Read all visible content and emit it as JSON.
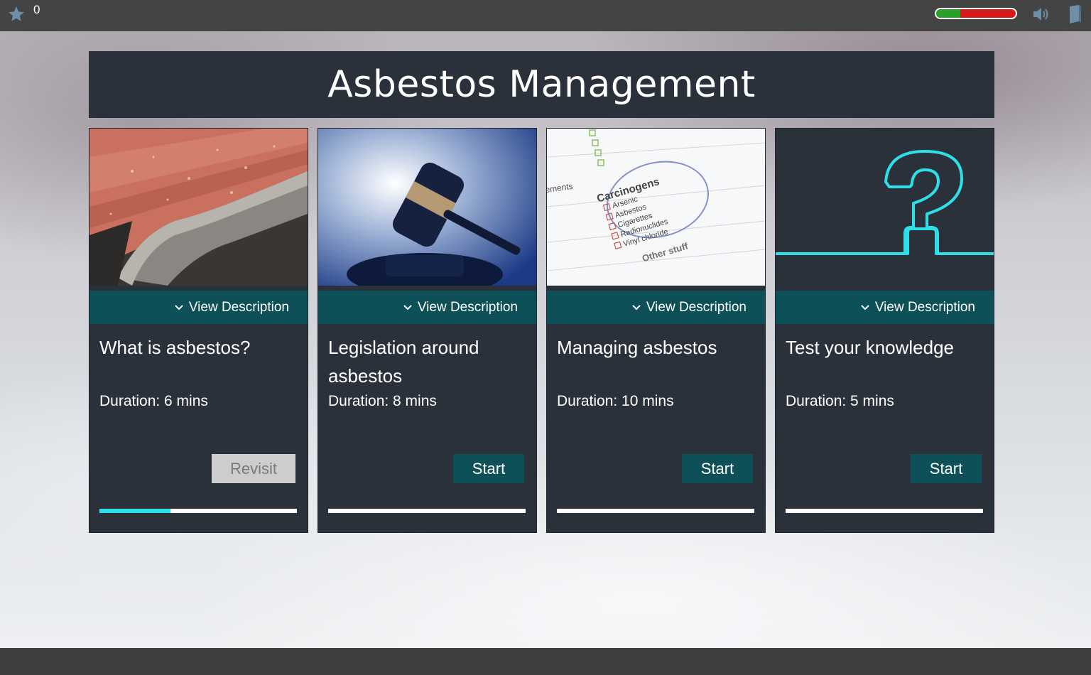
{
  "topbar": {
    "score": "0",
    "health_level": 0.3,
    "icons": [
      "star-icon",
      "speaker-icon",
      "book-icon"
    ]
  },
  "page": {
    "title": "Asbestos Management"
  },
  "cards": [
    {
      "image": "asbestos-roof-image",
      "view_description": "View Description",
      "title": "What is asbestos?",
      "duration": "Duration: 6 mins",
      "button": "Revisit",
      "progress": 0.36
    },
    {
      "image": "gavel-image",
      "view_description": "View Description",
      "title": "Legislation around asbestos",
      "duration": "Duration: 8 mins",
      "button": "Start",
      "progress": 0
    },
    {
      "image": "carcinogens-checklist-image",
      "image_text": [
        "Carcinogens",
        "Arsenic",
        "Asbestos",
        "Cigarettes",
        "Radionuclides",
        "Vinyl chloride",
        "Other stuff",
        "ements"
      ],
      "view_description": "View Description",
      "title": "Managing asbestos",
      "duration": "Duration: 10 mins",
      "button": "Start",
      "progress": 0
    },
    {
      "image": "question-mark-image",
      "view_description": "View Description",
      "title": "Test your knowledge",
      "duration": "Duration: 5 mins",
      "button": "Start",
      "progress": 0
    }
  ],
  "colors": {
    "panel": "#2b313b",
    "accent_teal": "#0e5058",
    "progress_cyan": "#2de0e8",
    "health_green": "#2aa02a",
    "health_red": "#d7191c"
  }
}
